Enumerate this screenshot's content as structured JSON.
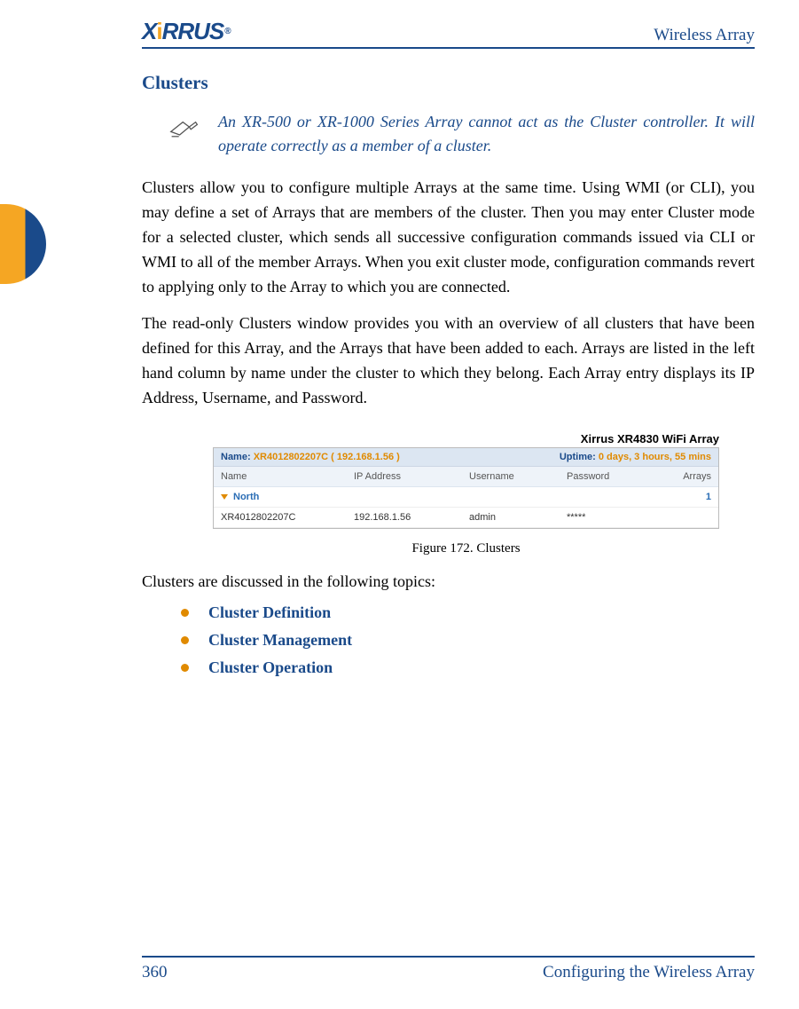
{
  "header": {
    "logo_text": "XIRRUS",
    "doc_title": "Wireless Array"
  },
  "section": {
    "title": "Clusters",
    "note": "An XR-500 or XR-1000 Series Array cannot act as the Cluster controller. It will operate correctly as a member of a cluster.",
    "para1": "Clusters allow you to configure multiple Arrays at the same time. Using WMI (or CLI), you may define a set of Arrays that are members of the cluster. Then you may enter Cluster mode for a selected cluster, which sends all successive configuration commands issued via CLI or WMI to all of the member Arrays. When you exit cluster mode, configuration commands revert to applying only to the Array to which you are connected.",
    "para2": "The read-only Clusters window provides you with an overview of all clusters that have been defined for this Array, and the Arrays that have been added to each. Arrays are listed in the left hand column by name under the cluster to which they belong. Each Array entry displays its IP Address, Username, and Password.",
    "topics_intro": "Clusters are discussed in the following topics:",
    "topics": [
      "Cluster Definition",
      "Cluster Management",
      "Cluster Operation"
    ]
  },
  "screenshot": {
    "product_title": "Xirrus XR4830 WiFi Array",
    "name_label": "Name:",
    "name_value": "XR4012802207C   ( 192.168.1.56 )",
    "uptime_label": "Uptime:",
    "uptime_value": "0 days, 3 hours, 55 mins",
    "columns": {
      "name": "Name",
      "ip": "IP Address",
      "user": "Username",
      "pass": "Password",
      "arrays": "Arrays"
    },
    "cluster_name": "North",
    "cluster_count": "1",
    "row": {
      "name": "XR4012802207C",
      "ip": "192.168.1.56",
      "user": "admin",
      "pass": "*****"
    }
  },
  "figure_caption": "Figure 172. Clusters",
  "footer": {
    "page": "360",
    "chapter": "Configuring the Wireless Array"
  }
}
